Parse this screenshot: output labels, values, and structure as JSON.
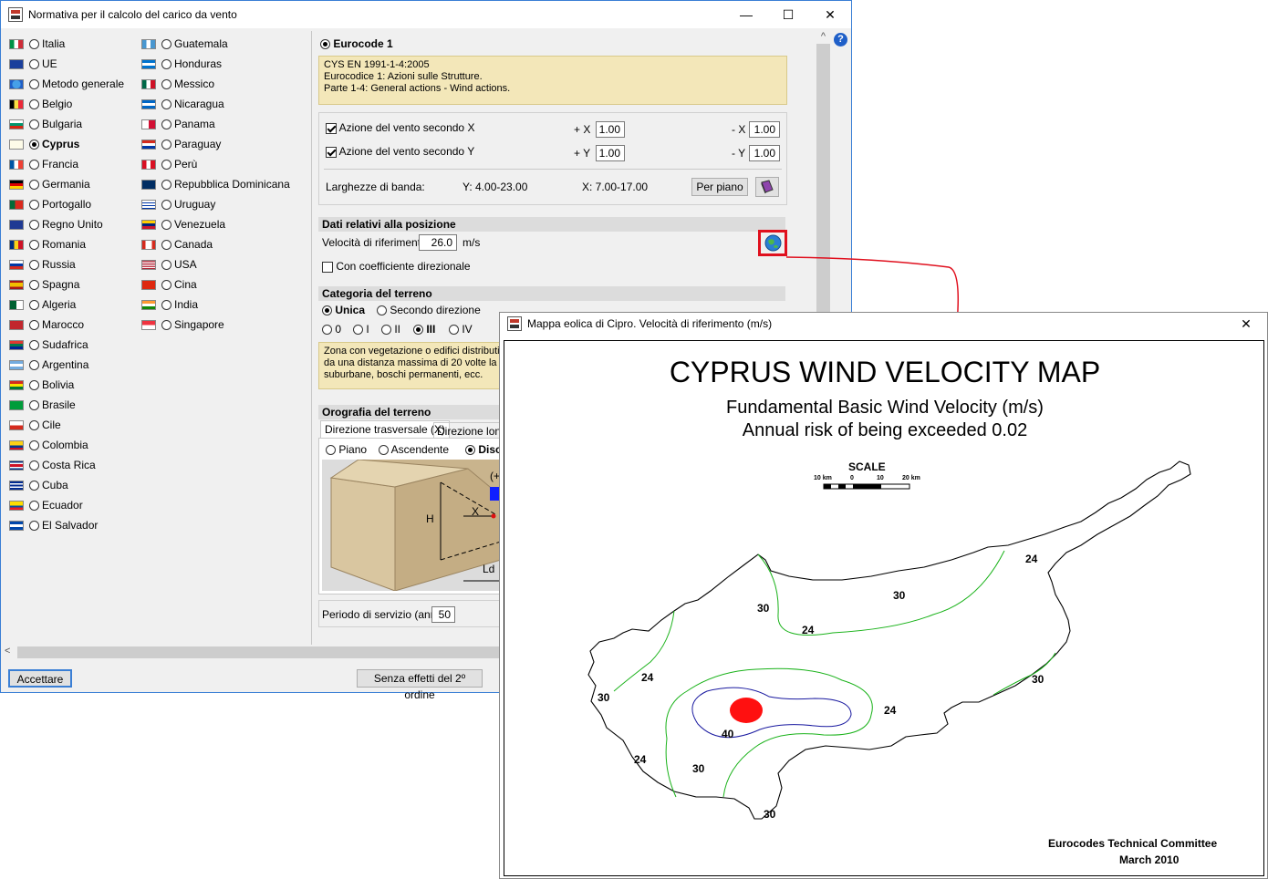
{
  "main_window": {
    "title": "Normativa per il calcolo del carico da vento",
    "minimize": "—",
    "maximize": "☐",
    "close": "✕",
    "countries_col1": [
      {
        "name": "Italia",
        "selected": false
      },
      {
        "name": "UE",
        "selected": false
      },
      {
        "name": "Metodo generale",
        "selected": false
      },
      {
        "name": "Belgio",
        "selected": false
      },
      {
        "name": "Bulgaria",
        "selected": false
      },
      {
        "name": "Cyprus",
        "selected": true
      },
      {
        "name": "Francia",
        "selected": false
      },
      {
        "name": "Germania",
        "selected": false
      },
      {
        "name": "Portogallo",
        "selected": false
      },
      {
        "name": "Regno Unito",
        "selected": false
      },
      {
        "name": "Romania",
        "selected": false
      },
      {
        "name": "Russia",
        "selected": false
      },
      {
        "name": "Spagna",
        "selected": false
      },
      {
        "name": "Algeria",
        "selected": false
      },
      {
        "name": "Marocco",
        "selected": false
      },
      {
        "name": "Sudafrica",
        "selected": false
      },
      {
        "name": "Argentina",
        "selected": false
      },
      {
        "name": "Bolivia",
        "selected": false
      },
      {
        "name": "Brasile",
        "selected": false
      },
      {
        "name": "Cile",
        "selected": false
      },
      {
        "name": "Colombia",
        "selected": false
      },
      {
        "name": "Costa Rica",
        "selected": false
      },
      {
        "name": "Cuba",
        "selected": false
      },
      {
        "name": "Ecuador",
        "selected": false
      },
      {
        "name": "El Salvador",
        "selected": false
      }
    ],
    "countries_col2": [
      {
        "name": "Guatemala",
        "selected": false
      },
      {
        "name": "Honduras",
        "selected": false
      },
      {
        "name": "Messico",
        "selected": false
      },
      {
        "name": "Nicaragua",
        "selected": false
      },
      {
        "name": "Panama",
        "selected": false
      },
      {
        "name": "Paraguay",
        "selected": false
      },
      {
        "name": "Perù",
        "selected": false
      },
      {
        "name": "Repubblica Dominicana",
        "selected": false
      },
      {
        "name": "Uruguay",
        "selected": false
      },
      {
        "name": "Venezuela",
        "selected": false
      },
      {
        "name": "Canada",
        "selected": false
      },
      {
        "name": "USA",
        "selected": false
      },
      {
        "name": "Cina",
        "selected": false
      },
      {
        "name": "India",
        "selected": false
      },
      {
        "name": "Singapore",
        "selected": false
      }
    ],
    "eurocode_label": "Eurocode 1",
    "norm_info": "CYS EN 1991-1-4:2005\nEurocodice 1: Azioni sulle Strutture.\nParte 1-4: General actions - Wind actions.",
    "wind_x_label": "Azione del vento secondo X",
    "wind_y_label": "Azione del vento secondo Y",
    "plus_x": "+ X",
    "minus_x": "- X",
    "plus_y": "+ Y",
    "minus_y": "- Y",
    "plus_x_val": "1.00",
    "minus_x_val": "1.00",
    "plus_y_val": "1.00",
    "minus_y_val": "1.00",
    "band_label": "Larghezze di banda:",
    "band_y": "Y: 4.00-23.00",
    "band_x": "X: 7.00-17.00",
    "per_piano": "Per piano",
    "position_head": "Dati relativi alla posizione",
    "ref_speed_label": "Velocità di riferimento",
    "ref_speed_val": "26.0",
    "ref_speed_unit": "m/s",
    "dir_coeff_label": "Con coefficiente direzionale",
    "terrain_head": "Categoria del terreno",
    "unica": "Unica",
    "secondo_direzione": "Secondo direzione",
    "cat_0": "0",
    "cat_1": "I",
    "cat_2": "II",
    "cat_3": "III",
    "cat_4": "IV",
    "terrain_info": "Zona con vegetazione o edifici distributi\nda una distanza massima di 20 volte la lo\nsuburbane, boschi permanenti, ecc.",
    "orography_head": "Orografia del terreno",
    "tab_transversal": "Direzione trasversale (X)",
    "tab_longitudinal": "Direzione longi",
    "piano": "Piano",
    "ascendente": "Ascendente",
    "disc": "Disc",
    "diagram_h": "H",
    "diagram_x": "X",
    "diagram_ld": "Ld",
    "diagram_plus": "(+",
    "periodo_label": "Periodo di servizio (anni)",
    "periodo_val": "50",
    "accept": "Accettare",
    "senza": "Senza effetti del 2º ordine",
    "help": "?",
    "scroll_up": "^",
    "scroll_left": "<"
  },
  "map_window": {
    "title": "Mappa eolica di Cipro. Velocità di riferimento (m/s)",
    "close": "✕",
    "map_title": "CYPRUS WIND VELOCITY MAP",
    "subtitle1": "Fundamental Basic Wind Velocity (m/s)",
    "subtitle2": "Annual risk of being exceeded 0.02",
    "scale_label": "SCALE",
    "scale_10a": "10 km",
    "scale_0": "0",
    "scale_10b": "10",
    "scale_20": "20 km",
    "credit1": "Eurocodes Technical Committee",
    "credit2": "March 2010",
    "contour_labels": [
      "24",
      "30",
      "30",
      "24",
      "30",
      "24",
      "30",
      "40",
      "24",
      "24",
      "30",
      "30"
    ]
  },
  "colors": {
    "accent": "#3a7fd5",
    "info_bg": "#f3e7b9",
    "highlight": "#e0101e",
    "contour_green": "#19b219",
    "contour_blue": "#1a1aa0",
    "core_red": "#ff1010"
  }
}
